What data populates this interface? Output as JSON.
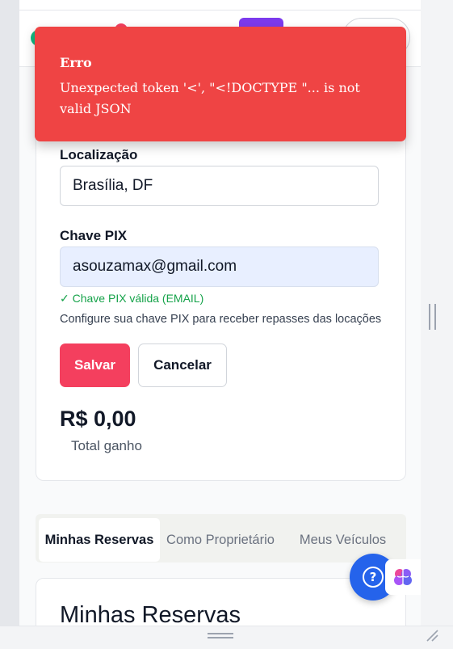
{
  "error_toast": {
    "title": "Erro",
    "message": "Unexpected token '<', \"<!DOCTYPE \"... is not valid JSON"
  },
  "profile": {
    "location_label": "Localização",
    "location_value": "Brasília, DF",
    "pix_label": "Chave PIX",
    "pix_value": "asouzamax@gmail.com",
    "pix_valid": "✓ Chave PIX válida (EMAIL)",
    "pix_help": "Configure sua chave PIX para receber repasses das locações",
    "save_label": "Salvar",
    "cancel_label": "Cancelar",
    "earnings_value": "R$ 0,00",
    "earnings_label": "Total ganho"
  },
  "tabs": [
    {
      "label": "Minhas Reservas",
      "active": true
    },
    {
      "label": "Como Proprietário",
      "active": false
    },
    {
      "label": "Meus Veículos",
      "active": false
    }
  ],
  "reservations": {
    "title": "Minhas Reservas"
  },
  "help_button": {
    "icon": "help-icon",
    "glyph": "?"
  },
  "ai_button": {
    "icon": "brain-icon"
  },
  "colors": {
    "error": "#ef4444",
    "primary": "#f43f5e",
    "success": "#16a34a",
    "fab": "#2563eb",
    "input_filled": "#e8efff"
  }
}
